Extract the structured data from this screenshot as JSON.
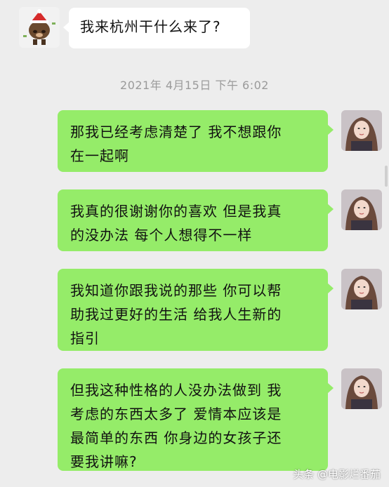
{
  "incoming_message": "我来杭州干什么来了?",
  "timestamp": "2021年 4月15日 下午 6:02",
  "outgoing_messages": [
    {
      "lines": [
        "那我已经考虑清楚了 我不想跟你",
        "在一起啊"
      ]
    },
    {
      "lines": [
        "我真的很谢谢你的喜欢 但是我真",
        "的没办法 每个人想得不一样"
      ]
    },
    {
      "lines": [
        "我知道你跟我说的那些 你可以帮",
        "助我过更好的生活 给我人生新的",
        "指引"
      ]
    },
    {
      "lines": [
        "但我这种性格的人没办法做到 我",
        "考虑的东西太多了 爱情本应该是",
        "最简单的东西 你身边的女孩子还",
        "要我讲嘛?"
      ]
    }
  ],
  "watermark": "头条 @电影烂番茄"
}
